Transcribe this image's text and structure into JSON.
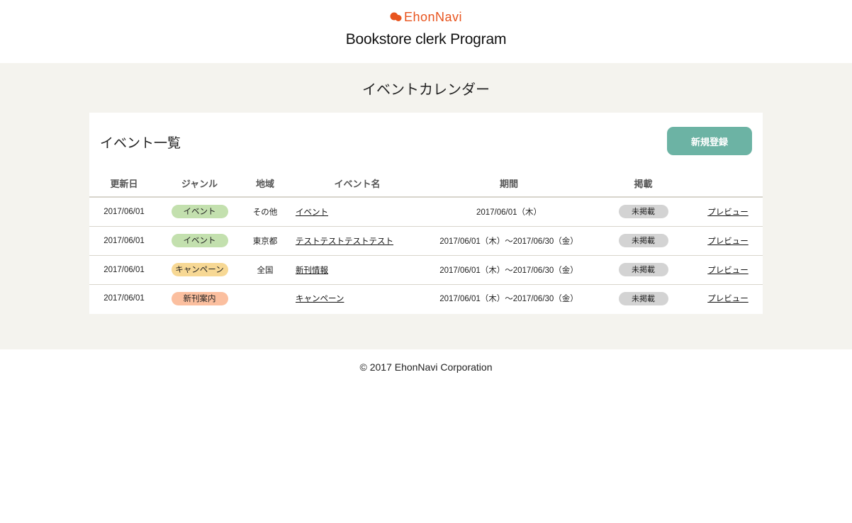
{
  "header": {
    "logo_text": "EhonNavi",
    "subtitle": "Bookstore clerk Program",
    "brand_color": "#e8541e"
  },
  "page": {
    "title": "イベントカレンダー"
  },
  "card": {
    "title": "イベント一覧",
    "new_button_label": "新規登録",
    "button_color": "#6cb3a4"
  },
  "table": {
    "columns": [
      "更新日",
      "ジャンル",
      "地域",
      "イベント名",
      "期間",
      "掲載",
      ""
    ],
    "rows": [
      {
        "updated": "2017/06/01",
        "genre": "イベント",
        "genre_color": "#c3e0ae",
        "region": "その他",
        "name": "イベント",
        "period": "2017/06/01（木）",
        "status": "未掲載",
        "action": "プレビュー"
      },
      {
        "updated": "2017/06/01",
        "genre": "イベント",
        "genre_color": "#c3e0ae",
        "region": "東京都",
        "name": "テストテストテストテスト",
        "period": "2017/06/01（木）～2017/06/30（金）",
        "status": "未掲載",
        "action": "プレビュー"
      },
      {
        "updated": "2017/06/01",
        "genre": "キャンペーン",
        "genre_color": "#f7d894",
        "region": "全国",
        "name": "新刊情報",
        "period": "2017/06/01（木）～2017/06/30（金）",
        "status": "未掲載",
        "action": "プレビュー"
      },
      {
        "updated": "2017/06/01",
        "genre": "新刊案内",
        "genre_color": "#fbbf9f",
        "region": "",
        "name": "キャンペーン",
        "period": "2017/06/01（木）～2017/06/30（金）",
        "status": "未掲載",
        "action": "プレビュー"
      }
    ]
  },
  "footer": {
    "copyright": "© 2017 EhonNavi Corporation"
  }
}
